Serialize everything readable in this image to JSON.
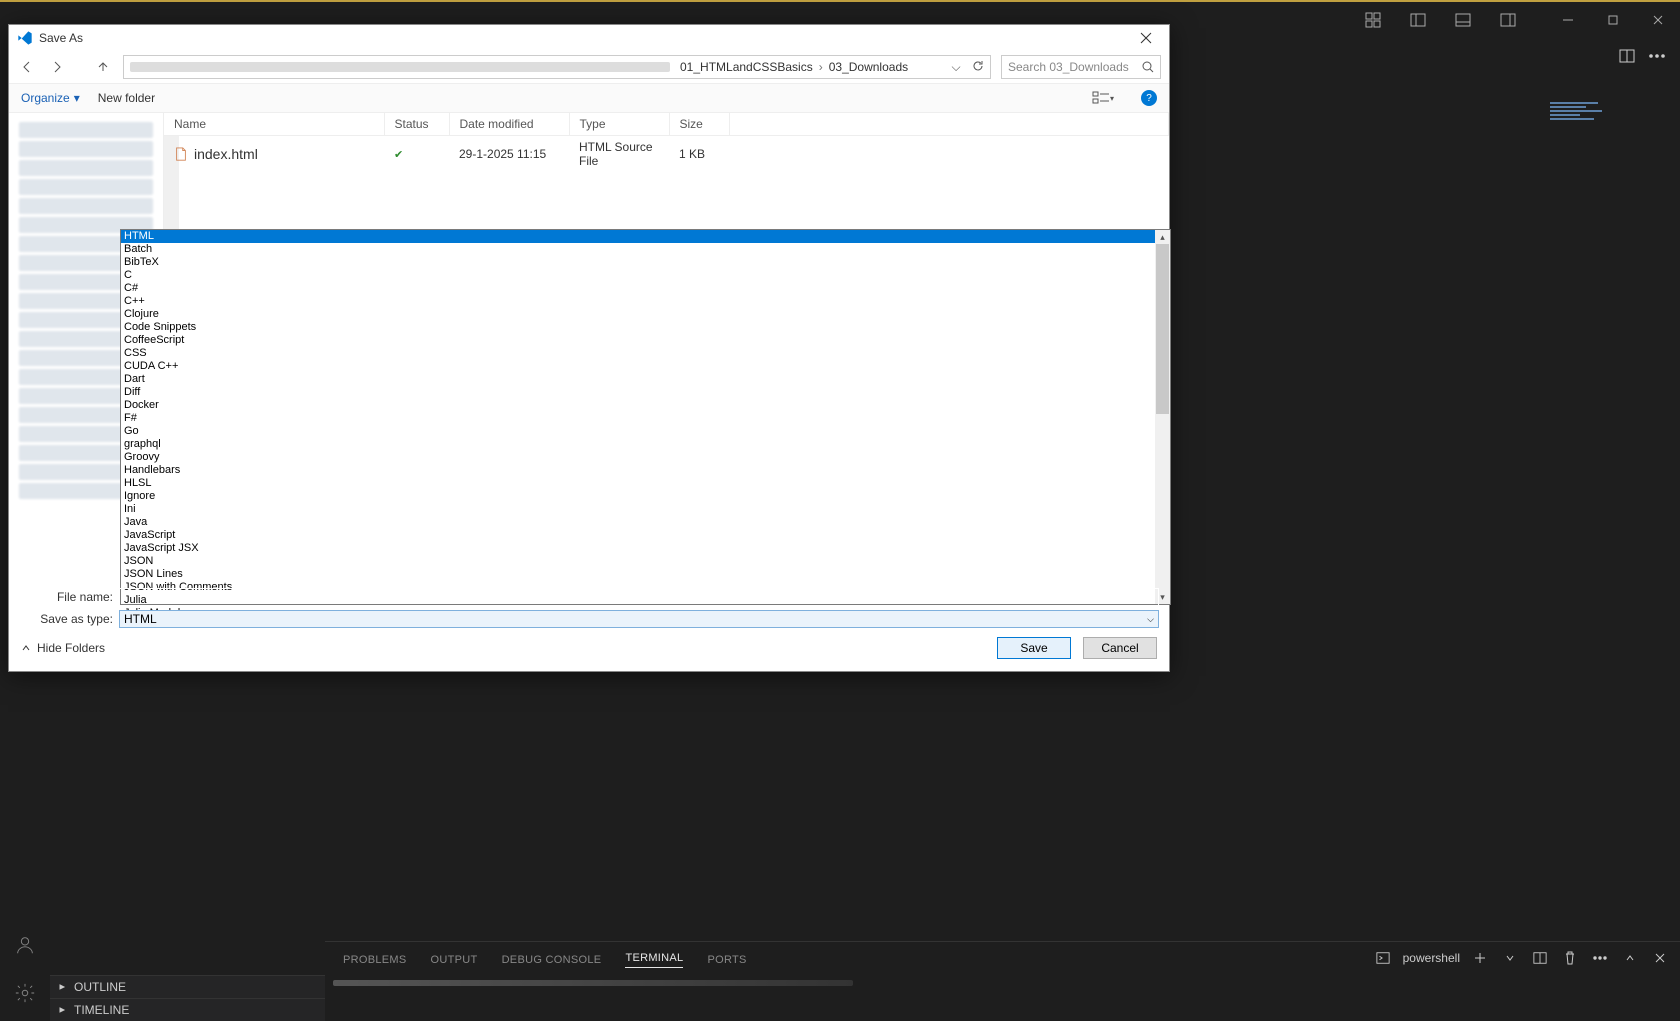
{
  "vscode": {
    "title_icons": {
      "min": "–",
      "max": "❐",
      "close": "✕"
    },
    "panel": {
      "tabs": [
        "PROBLEMS",
        "OUTPUT",
        "DEBUG CONSOLE",
        "TERMINAL",
        "PORTS"
      ],
      "active_tab": "TERMINAL",
      "shell_label": "powershell"
    },
    "sidebar_sections": [
      "OUTLINE",
      "TIMELINE"
    ]
  },
  "dialog": {
    "title": "Save As",
    "breadcrumb": [
      "01_HTMLandCSSBasics",
      "03_Downloads"
    ],
    "search_placeholder": "Search 03_Downloads",
    "toolbar": {
      "organize": "Organize",
      "new_folder": "New folder"
    },
    "columns": {
      "name": "Name",
      "status": "Status",
      "date": "Date modified",
      "type": "Type",
      "size": "Size"
    },
    "files": [
      {
        "name": "index.html",
        "status": "ok",
        "date": "29-1-2025 11:15",
        "type": "HTML Source File",
        "size": "1 KB"
      }
    ],
    "type_dropdown": {
      "selected": "HTML",
      "options": [
        "HTML",
        "Batch",
        "BibTeX",
        "C",
        "C#",
        "C++",
        "Clojure",
        "Code Snippets",
        "CoffeeScript",
        "CSS",
        "CUDA C++",
        "Dart",
        "Diff",
        "Docker",
        "F#",
        "Go",
        "graphql",
        "Groovy",
        "Handlebars",
        "HLSL",
        "Ignore",
        "Ini",
        "Java",
        "JavaScript",
        "JavaScript JSX",
        "JSON",
        "JSON Lines",
        "JSON with Comments",
        "Julia",
        "Julia Markdown"
      ]
    },
    "labels": {
      "file_name": "File name:",
      "save_as_type": "Save as type:"
    },
    "save_as_type_value": "HTML",
    "footer": {
      "hide": "Hide Folders",
      "save": "Save",
      "cancel": "Cancel"
    }
  }
}
